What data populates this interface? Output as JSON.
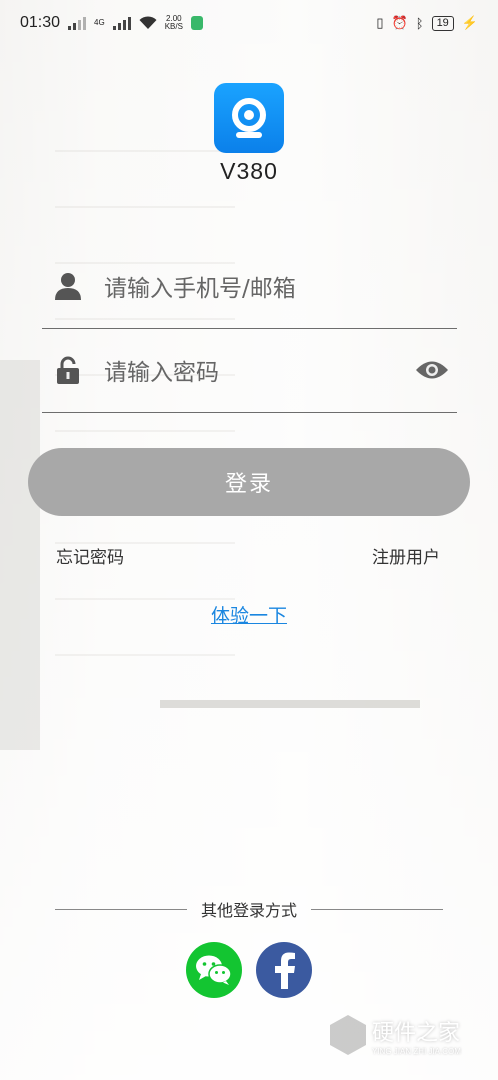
{
  "statusbar": {
    "time": "01:30",
    "net_speed": "2.00",
    "net_unit": "KB/S",
    "network_type": "4G",
    "battery": "19"
  },
  "app": {
    "name": "V380",
    "logo_color": "#1a8ff0"
  },
  "form": {
    "username_placeholder": "请输入手机号/邮箱",
    "password_placeholder": "请输入密码",
    "login_label": "登录",
    "forgot_label": "忘记密码",
    "register_label": "注册用户",
    "trial_label": "体验一下"
  },
  "other_login": {
    "title": "其他登录方式",
    "methods": [
      {
        "icon": "wechat-icon",
        "color": "#13c531"
      },
      {
        "icon": "facebook-icon",
        "color": "#3b5aa0"
      }
    ]
  },
  "watermark": {
    "main": "硬件之家",
    "sub": "YING JIAN ZHI JIA.COM"
  }
}
